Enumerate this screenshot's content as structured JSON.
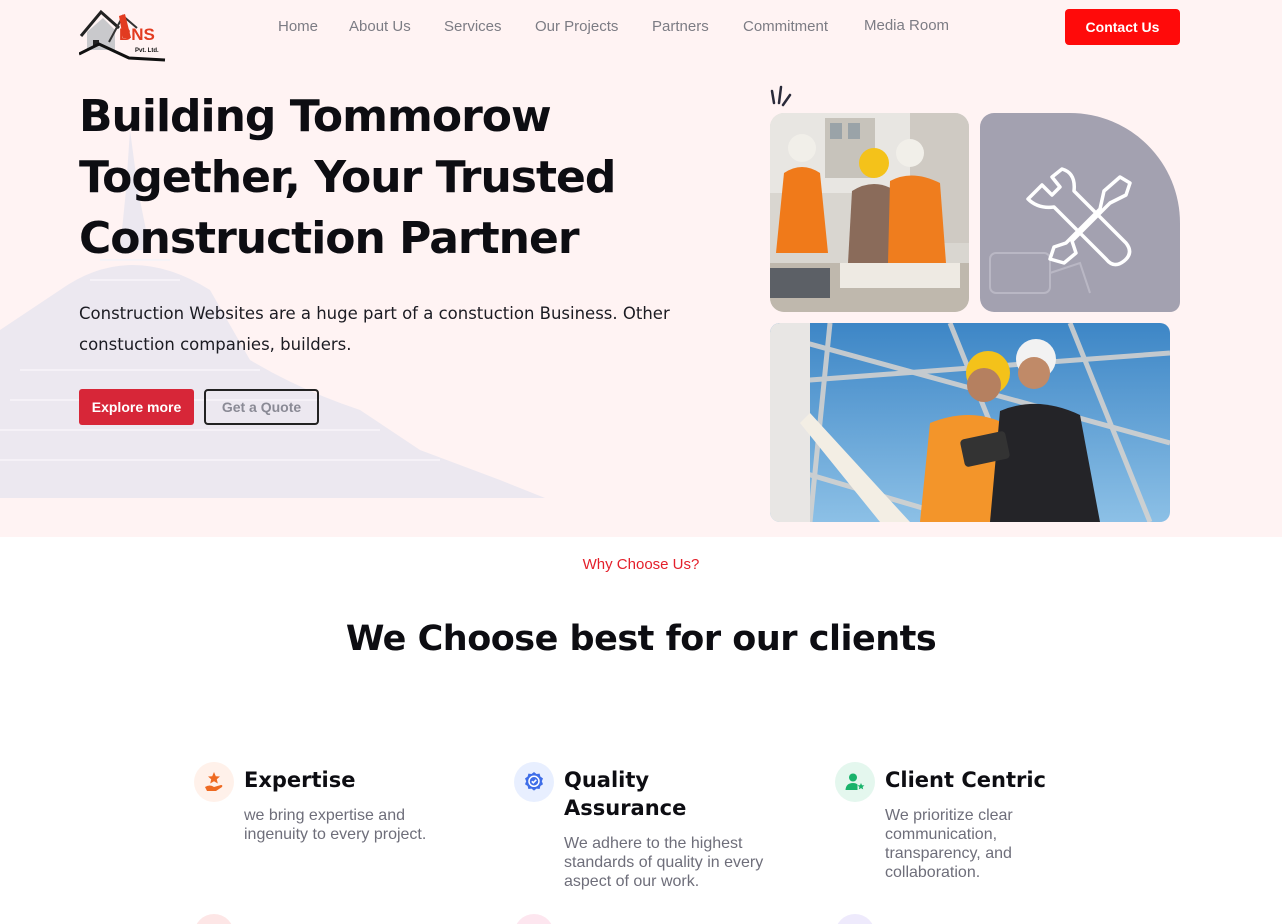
{
  "brand": {
    "logo_text": "BNS",
    "logo_sub": "Pvt. Ltd."
  },
  "nav": {
    "items": [
      "Home",
      "About Us",
      "Services",
      "Our Projects",
      "Partners",
      "Commitment",
      "Media Room"
    ],
    "contact_label": "Contact Us"
  },
  "hero": {
    "title": "Building Tommorow Together, Your Trusted Construction Partner",
    "description": "Construction Websites are a huge part of a constuction Business. Other constuction companies, builders.",
    "explore_label": "Explore more",
    "quote_label": "Get a Quote"
  },
  "images": {
    "photo1": "engineers-reviewing-blueprints",
    "tool": "wrench-screwdriver-icon",
    "photo2": "engineers-with-tablet-at-steel-frame"
  },
  "why": {
    "kicker": "Why Choose Us?",
    "title": "We Choose best for our clients"
  },
  "features": [
    {
      "title": "Expertise",
      "desc": "we bring expertise and ingenuity to every project.",
      "icon": "hand-star-icon"
    },
    {
      "title": "Quality Assurance",
      "desc": "We adhere to the highest standards of quality in every aspect of our work.",
      "icon": "badge-check-icon"
    },
    {
      "title": "Client Centric",
      "desc": "We prioritize clear communication, transparency, and collaboration.",
      "icon": "user-star-icon"
    }
  ],
  "colors": {
    "accent": "#ff0a0a",
    "brand_red": "#d72638",
    "hero_bg": "#fff3f3",
    "kicker": "#e4202b"
  }
}
